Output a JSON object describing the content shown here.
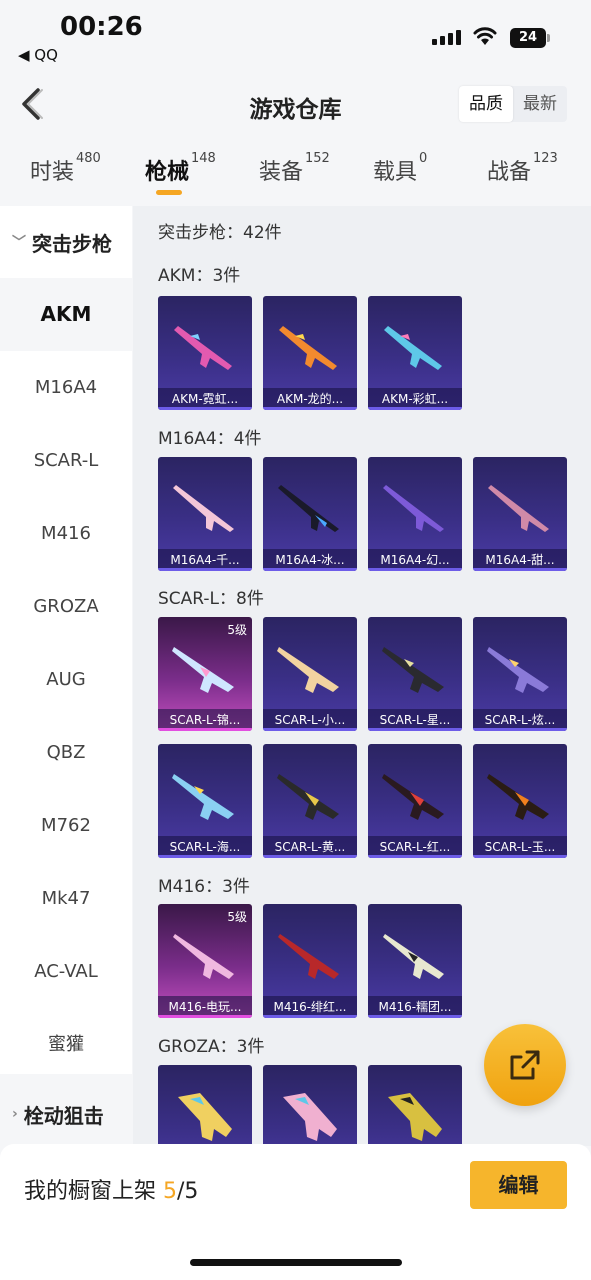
{
  "status": {
    "time": "00:26",
    "back_app": "◀ QQ",
    "battery": "24"
  },
  "header": {
    "title": "游戏仓库",
    "sort": [
      "品质",
      "最新"
    ]
  },
  "tabs": [
    {
      "label": "时装",
      "count": "480"
    },
    {
      "label": "枪械",
      "count": "148"
    },
    {
      "label": "装备",
      "count": "152"
    },
    {
      "label": "载具",
      "count": "0"
    },
    {
      "label": "战备",
      "count": "123"
    }
  ],
  "sidebar": {
    "group1": "突击步枪",
    "items": [
      "AKM",
      "M16A4",
      "SCAR-L",
      "M416",
      "GROZA",
      "AUG",
      "QBZ",
      "M762",
      "Mk47",
      "AC-VAL",
      "蜜獾"
    ],
    "group2": "栓动狙击"
  },
  "content": {
    "summary": "突击步枪：42件",
    "sections": [
      {
        "label": "AKM：3件",
        "cards": [
          "AKM-霓虹...",
          "AKM-龙的...",
          "AKM-彩虹..."
        ]
      },
      {
        "label": "M16A4：4件",
        "cards": [
          "M16A4-千...",
          "M16A4-冰...",
          "M16A4-幻...",
          "M16A4-甜..."
        ]
      },
      {
        "label": "SCAR-L：8件",
        "cards": [
          "SCAR-L-锦...",
          "SCAR-L-小...",
          "SCAR-L-星...",
          "SCAR-L-炫...",
          "SCAR-L-海...",
          "SCAR-L-黄...",
          "SCAR-L-红...",
          "SCAR-L-玉..."
        ]
      },
      {
        "label": "M416：3件",
        "cards": [
          "M416-电玩...",
          "M416-绯红...",
          "M416-糯团..."
        ]
      },
      {
        "label": "GROZA：3件",
        "cards": [
          "",
          "",
          ""
        ]
      }
    ],
    "level_badge": "5级"
  },
  "bottom": {
    "label": "我的橱窗上架 ",
    "count": "5",
    "total": "/5",
    "edit": "编辑"
  },
  "colors": {
    "accent": "#f5a623",
    "card": "#3a2f86",
    "card_premium": "#7a2d8a"
  }
}
